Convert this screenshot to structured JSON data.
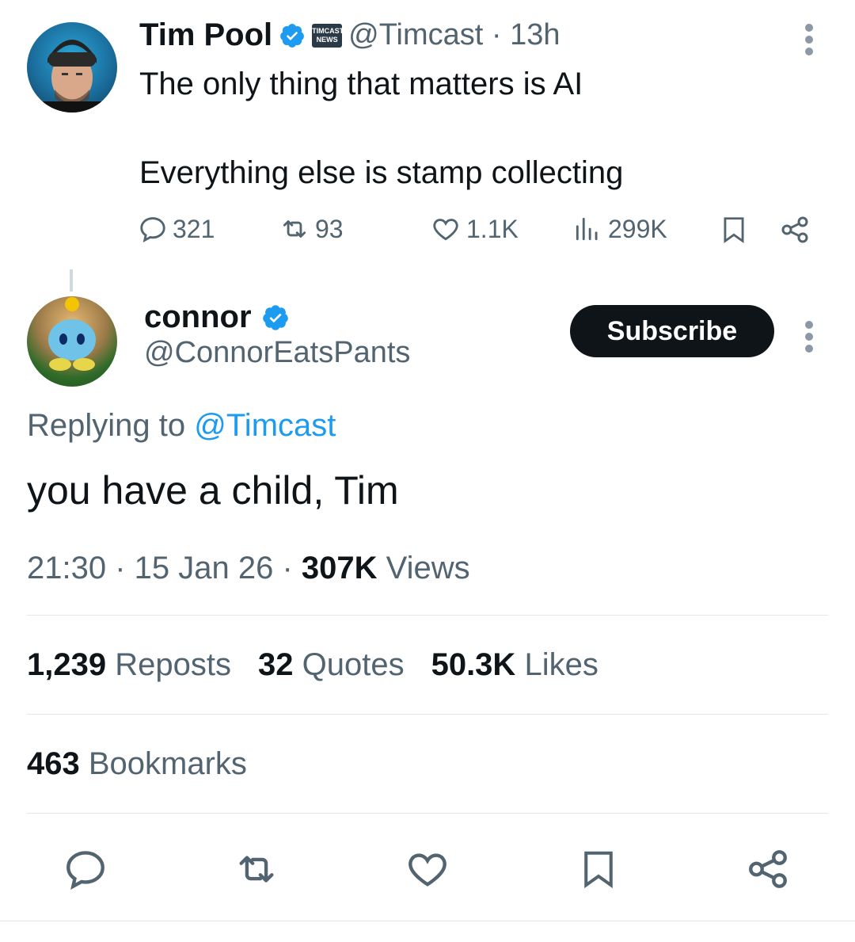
{
  "parent": {
    "name": "Tim Pool",
    "badge_text": "TIMCAST NEWS",
    "handle": "@Timcast",
    "sep": " · ",
    "time": "13h",
    "text_line1": "The only thing that matters is AI",
    "text_line2": "Everything else is stamp collecting",
    "replies": "321",
    "reposts": "93",
    "likes": "1.1K",
    "views": "299K"
  },
  "reply": {
    "name": "connor",
    "handle": "@ConnorEatsPants",
    "subscribe_label": "Subscribe",
    "replying_prefix": "Replying to",
    "replying_to": "@Timcast",
    "text": "you have a child, Tim",
    "time": "21:30",
    "date": "15 Jan 26",
    "views_count": "307K",
    "views_label": "Views",
    "reposts_count": "1,239",
    "reposts_label": "Reposts",
    "quotes_count": "32",
    "quotes_label": "Quotes",
    "likes_count": "50.3K",
    "likes_label": "Likes",
    "bookmarks_count": "463",
    "bookmarks_label": "Bookmarks"
  },
  "colors": {
    "accent": "#1d9bf0",
    "text": "#0f1419",
    "muted": "#536471",
    "divider": "#e1e8ed"
  }
}
